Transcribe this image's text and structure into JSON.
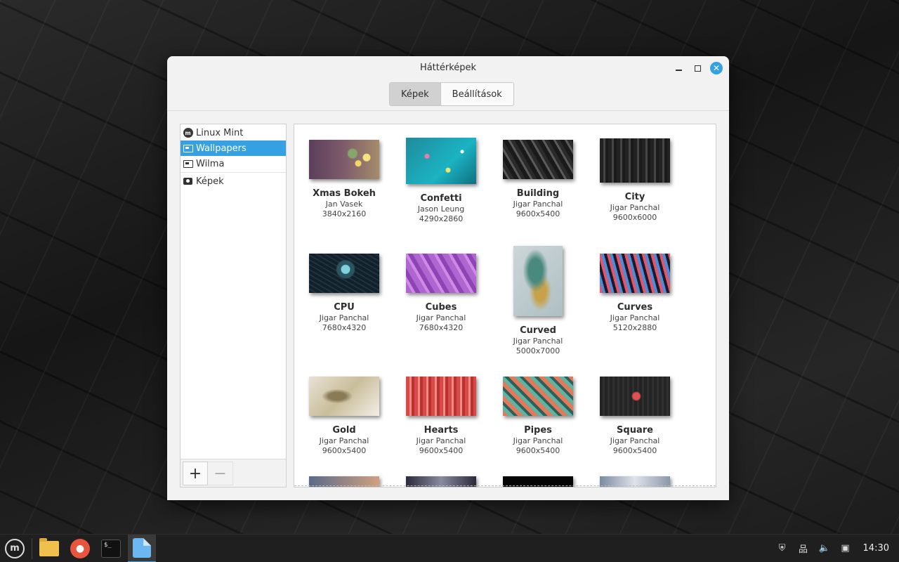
{
  "window": {
    "title": "Háttérképek",
    "tabs": [
      {
        "label": "Képek",
        "active": true
      },
      {
        "label": "Beállítások",
        "active": false
      }
    ],
    "close_symbol": "✕"
  },
  "sidebar": {
    "items": [
      {
        "label": "Linux Mint",
        "icon": "linux-mint-icon",
        "selected": false
      },
      {
        "label": "Wallpapers",
        "icon": "monitor-icon",
        "selected": true
      },
      {
        "label": "Wilma",
        "icon": "monitor-icon",
        "selected": false
      },
      {
        "label": "Képek",
        "icon": "camera-icon",
        "selected": false
      }
    ],
    "add_label": "+",
    "remove_label": "−"
  },
  "wallpapers": [
    {
      "name": "Xmas Bokeh",
      "author": "Jan Vasek",
      "size": "3840x2160"
    },
    {
      "name": "Confetti",
      "author": "Jason Leung",
      "size": "4290x2860"
    },
    {
      "name": "Building",
      "author": "Jigar Panchal",
      "size": "9600x5400"
    },
    {
      "name": "City",
      "author": "Jigar Panchal",
      "size": "9600x6000"
    },
    {
      "name": "CPU",
      "author": "Jigar Panchal",
      "size": "7680x4320"
    },
    {
      "name": "Cubes",
      "author": "Jigar Panchal",
      "size": "7680x4320"
    },
    {
      "name": "Curved",
      "author": "Jigar Panchal",
      "size": "5000x7000"
    },
    {
      "name": "Curves",
      "author": "Jigar Panchal",
      "size": "5120x2880"
    },
    {
      "name": "Gold",
      "author": "Jigar Panchal",
      "size": "9600x5400"
    },
    {
      "name": "Hearts",
      "author": "Jigar Panchal",
      "size": "9600x5400"
    },
    {
      "name": "Pipes",
      "author": "Jigar Panchal",
      "size": "9600x5400"
    },
    {
      "name": "Square",
      "author": "Jigar Panchal",
      "size": "9600x5400"
    }
  ],
  "taskbar": {
    "clock": "14:30",
    "mint_letter": "m",
    "terminal_prompt": "$_"
  },
  "colors": {
    "accent": "#35a1e2"
  }
}
